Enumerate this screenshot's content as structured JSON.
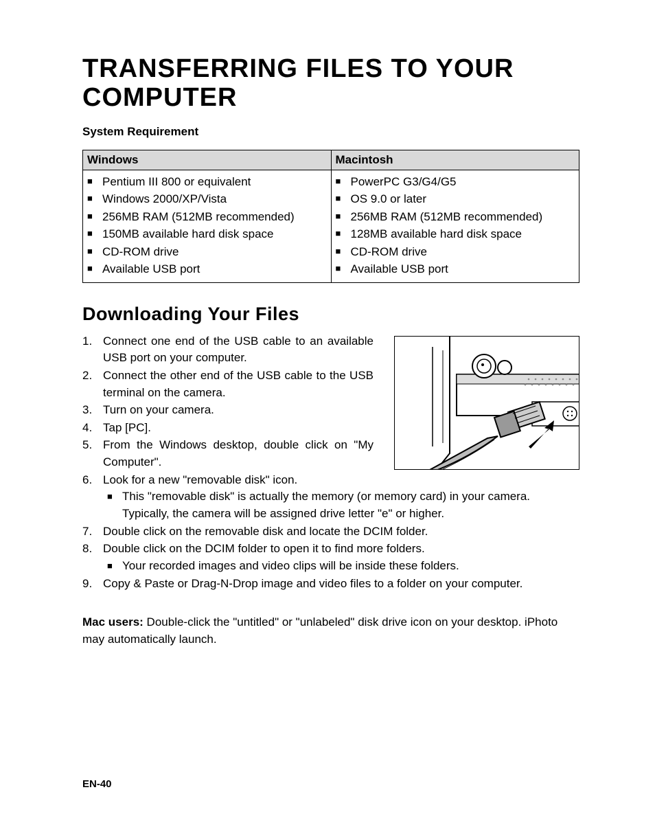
{
  "title": "TRANSFERRING FILES TO YOUR COMPUTER",
  "sys_req_label": "System Requirement",
  "table": {
    "headers": {
      "win": "Windows",
      "mac": "Macintosh"
    },
    "win": [
      "Pentium III 800 or equivalent",
      "Windows 2000/XP/Vista",
      "256MB RAM (512MB recommended)",
      "150MB available hard disk space",
      "CD-ROM drive",
      "Available USB port"
    ],
    "mac": [
      "PowerPC G3/G4/G5",
      "OS 9.0 or later",
      "256MB RAM (512MB recommended)",
      "128MB available hard disk space",
      "CD-ROM drive",
      "Available USB port"
    ]
  },
  "section_title": "Downloading Your Files",
  "steps": [
    {
      "text": "Connect one end of the USB cable to an available USB port on your computer.",
      "narrow": true
    },
    {
      "text": "Connect the other end of the USB cable to the USB terminal on the camera.",
      "narrow": true
    },
    {
      "text": "Turn on your camera.",
      "narrow": true
    },
    {
      "text": "Tap [PC].",
      "narrow": true
    },
    {
      "text": "From the Windows desktop, double click on \"My Computer\".",
      "narrow": true
    },
    {
      "text": "Look for a new \"removable disk\" icon.",
      "narrow": false,
      "sub": [
        "This \"removable disk\" is actually the memory (or memory card) in your camera. Typically, the camera will be assigned drive letter \"e\" or higher."
      ]
    },
    {
      "text": "Double click on the removable disk and locate the DCIM folder.",
      "narrow": false
    },
    {
      "text": "Double click on the DCIM folder to open it to find more folders.",
      "narrow": false,
      "sub": [
        "Your recorded images and video clips will be inside these folders."
      ]
    },
    {
      "text": "Copy & Paste or Drag-N-Drop image and video files to a folder on your computer.",
      "narrow": false
    }
  ],
  "mac_note": {
    "prefix": "Mac users:",
    "rest": " Double-click the \"untitled\" or \"unlabeled\" disk drive icon on your desktop. iPhoto may automatically launch."
  },
  "page_num": "EN-40"
}
